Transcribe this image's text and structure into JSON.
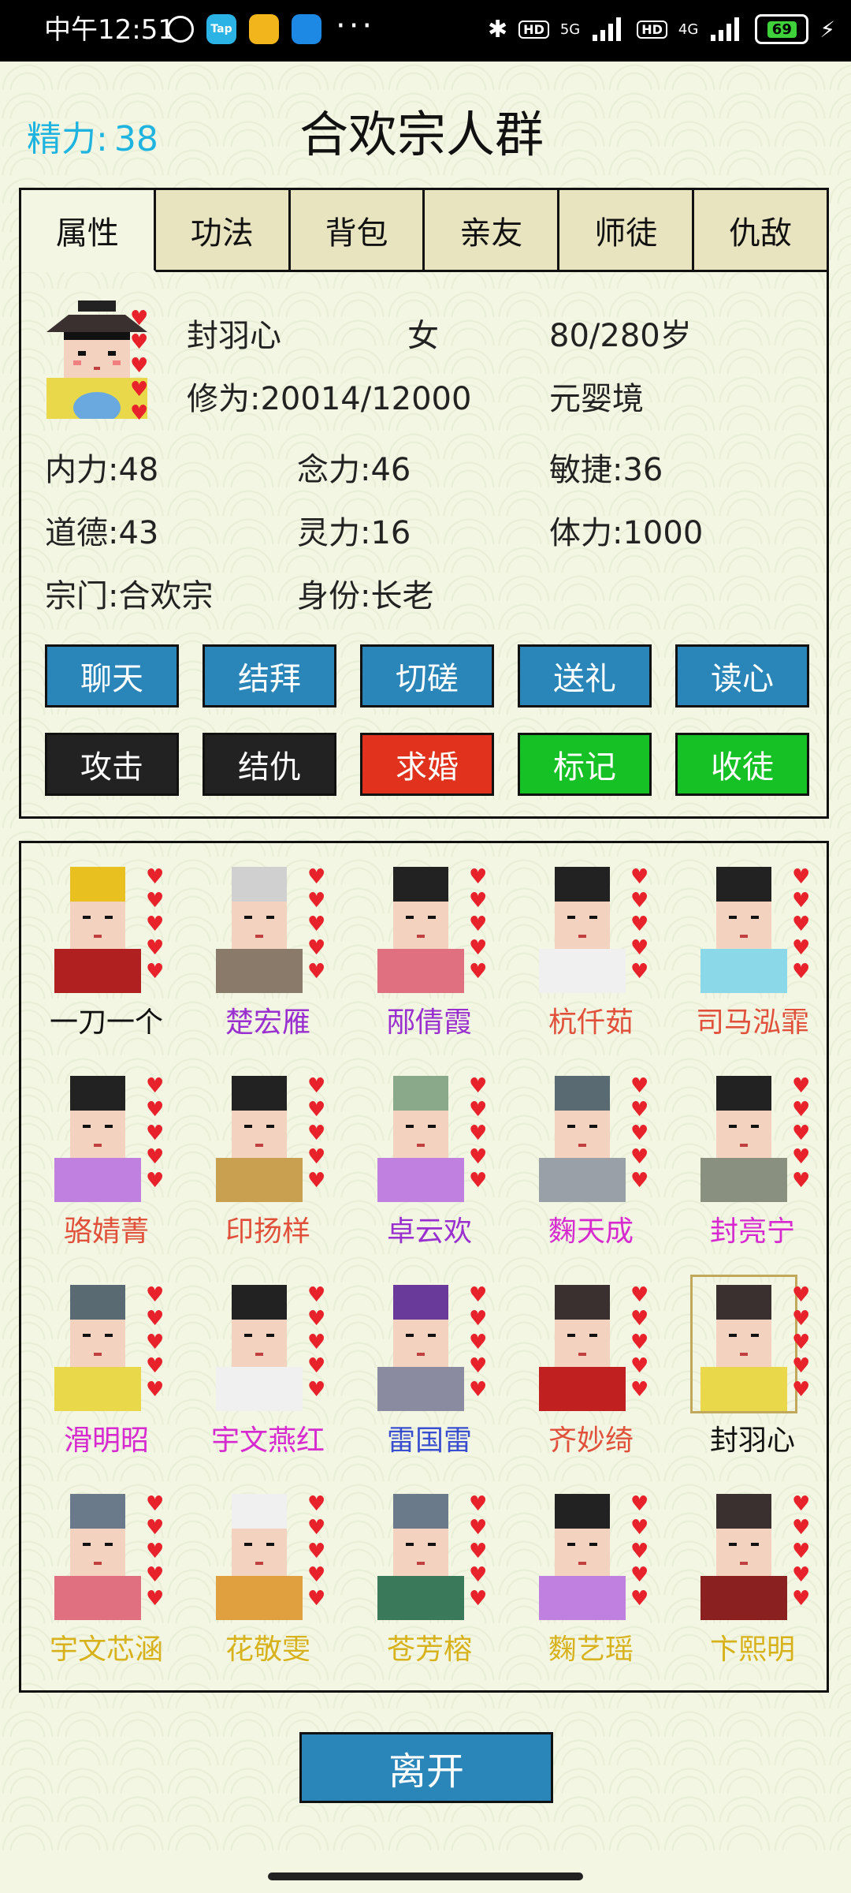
{
  "status_bar": {
    "time": "中午12:51",
    "network_labels": [
      "HD",
      "5G",
      "HD",
      "4G"
    ],
    "battery": "69"
  },
  "header": {
    "energy_label": "精力:",
    "energy_value": "38",
    "title": "合欢宗人群"
  },
  "tabs": [
    "属性",
    "功法",
    "背包",
    "亲友",
    "师徒",
    "仇敌"
  ],
  "character": {
    "name": "封羽心",
    "gender": "女",
    "age": "80/280岁",
    "cultivation": "修为:20014/12000",
    "realm": "元婴境",
    "stats": [
      {
        "label": "内力:",
        "value": "48"
      },
      {
        "label": "念力:",
        "value": "46"
      },
      {
        "label": "敏捷:",
        "value": "36"
      },
      {
        "label": "道德:",
        "value": "43"
      },
      {
        "label": "灵力:",
        "value": "16"
      },
      {
        "label": "体力:",
        "value": "1000"
      }
    ],
    "sect": "宗门:合欢宗",
    "identity": "身份:长老"
  },
  "actions_row1": [
    "聊天",
    "结拜",
    "切磋",
    "送礼",
    "读心"
  ],
  "actions_row2": [
    "攻击",
    "结仇",
    "求婚",
    "标记",
    "收徒"
  ],
  "people": [
    {
      "name": "一刀一个",
      "color": "#111111"
    },
    {
      "name": "楚宏雁",
      "color": "#9a2fd0"
    },
    {
      "name": "邴倩霞",
      "color": "#9a2fd0"
    },
    {
      "name": "杭仟茹",
      "color": "#e0503a"
    },
    {
      "name": "司马泓霏",
      "color": "#e0503a"
    },
    {
      "name": "骆婧菁",
      "color": "#e0503a"
    },
    {
      "name": "印扬样",
      "color": "#e0503a"
    },
    {
      "name": "卓云欢",
      "color": "#9a2fd0"
    },
    {
      "name": "麴天成",
      "color": "#d62ad0"
    },
    {
      "name": "封亮宁",
      "color": "#d62ad0"
    },
    {
      "name": "滑明昭",
      "color": "#d62ad0"
    },
    {
      "name": "宇文燕红",
      "color": "#d62ad0"
    },
    {
      "name": "雷国雷",
      "color": "#3a4fd0"
    },
    {
      "name": "齐妙绮",
      "color": "#e0503a"
    },
    {
      "name": "封羽心",
      "color": "#111111"
    },
    {
      "name": "宇文芯涵",
      "color": "#d8b21c"
    },
    {
      "name": "花敬雯",
      "color": "#d8b21c"
    },
    {
      "name": "苍芳榕",
      "color": "#d8b21c"
    },
    {
      "name": "麴艺瑶",
      "color": "#d8b21c"
    },
    {
      "name": "卞熙明",
      "color": "#d8b21c"
    }
  ],
  "leave_button": "离开"
}
